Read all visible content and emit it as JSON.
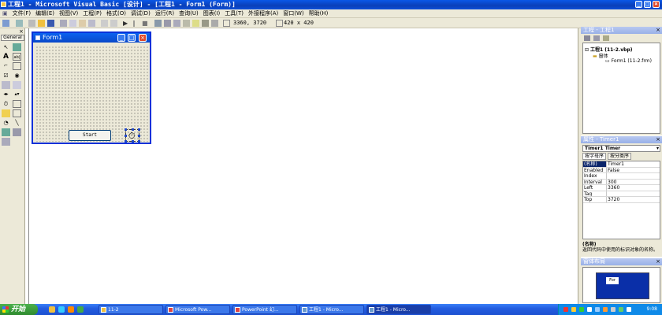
{
  "main_window": {
    "title": "工程1 - Microsoft Visual Basic [设计] - [工程1 - Form1 (Form)]",
    "min": "_",
    "max": "□",
    "close": "×"
  },
  "menu": [
    "文件(F)",
    "编辑(E)",
    "视图(V)",
    "工程(P)",
    "格式(O)",
    "调试(D)",
    "运行(R)",
    "查询(U)",
    "图表(I)",
    "工具(T)",
    "外接程序(A)",
    "窗口(W)",
    "帮助(H)"
  ],
  "toolbar": {
    "coords": "3360, 3720",
    "size": "420 x 420"
  },
  "toolbox": {
    "tab": "General"
  },
  "form": {
    "title": "Form1",
    "start_button": "Start",
    "timer_glyph": "⏱"
  },
  "project": {
    "title": "工程 - 工程1",
    "root": "工程1 (11-2.vbp)",
    "folder": "窗体",
    "item": "Form1 (11-2.frm)"
  },
  "properties": {
    "title": "属性 - Timer1",
    "object": "Timer1 Timer",
    "tab_alpha": "按字母序",
    "tab_cat": "按分类序",
    "rows": [
      {
        "k": "(名称)",
        "v": "Timer1"
      },
      {
        "k": "Enabled",
        "v": "False"
      },
      {
        "k": "Index",
        "v": ""
      },
      {
        "k": "Interval",
        "v": "300"
      },
      {
        "k": "Left",
        "v": "3360"
      },
      {
        "k": "Tag",
        "v": ""
      },
      {
        "k": "Top",
        "v": "3720"
      }
    ],
    "desc_title": "(名称)",
    "desc_text": "返回代码中使用的标识对象的名称。"
  },
  "form_layout": {
    "title": "窗体布局",
    "mini_label": "For"
  },
  "taskbar": {
    "start": "开始",
    "tasks": [
      "11-2",
      "Microsoft Pow...",
      "PowerPoint 幻...",
      "工程1 - Micro...",
      "工程1 - Micro..."
    ],
    "clock": "9:08"
  }
}
